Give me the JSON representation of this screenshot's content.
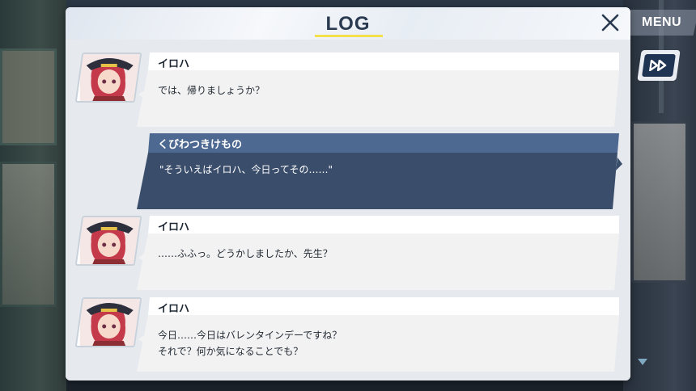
{
  "header": {
    "title": "LOG",
    "close_icon": "close-icon"
  },
  "menu_button": {
    "label": "MENU"
  },
  "skip_button": {
    "icon": "fast-forward-icon"
  },
  "entries": [
    {
      "speaker": "イロハ",
      "lines": [
        "では、帰りましょうか？"
      ],
      "type": "npc"
    },
    {
      "speaker": "くびわつきけもの",
      "lines": [
        "\"そういえばイロハ、今日ってその……\""
      ],
      "type": "player"
    },
    {
      "speaker": "イロハ",
      "lines": [
        "……ふふっ。どうかしましたか、先生？"
      ],
      "type": "npc"
    },
    {
      "speaker": "イロハ",
      "lines": [
        "今日……今日はバレンタインデーですね？",
        "それで？何か気になることでも？"
      ],
      "type": "npc"
    }
  ],
  "colors": {
    "panel": "#f3f5f8",
    "title": "#2a3a50",
    "title_underline": "#f4e04a",
    "player_bubble": "#3a4d6b",
    "player_header": "#4d6891",
    "npc_bubble": "#f2f2f2",
    "npc_header": "#ffffff"
  }
}
